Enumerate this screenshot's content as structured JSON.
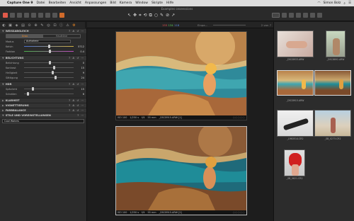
{
  "menubar": {
    "app_name": "Capture One 9",
    "menus": [
      "Datei",
      "Bearbeiten",
      "Ansicht",
      "Anpassungen",
      "Bild",
      "Kamera",
      "Window",
      "Skripte",
      "Hilfe"
    ],
    "user": "Simon Bolz"
  },
  "toolbar": {
    "document_name": "Examples ceseessions"
  },
  "tool_tabs": [
    "◐",
    "▣",
    "◈",
    "▤",
    "⊙",
    "⊕",
    "✎",
    "◎",
    "⊡",
    "ⓘ",
    "⚠",
    "⚙"
  ],
  "left_panel": {
    "white_balance": {
      "title": "WEISSABGLEICH",
      "tabs": [
        "Grau",
        "Hauttöne"
      ],
      "mode_label": "Modus",
      "mode_value": "Aufnahme",
      "kelvin_label": "Kelvin",
      "kelvin_value": "5712",
      "tint_label": "Farbton",
      "tint_value": "0.4"
    },
    "exposure": {
      "title": "BELICHTUNG",
      "rows": [
        {
          "label": "Belichtung",
          "value": "0",
          "pos": 0.5
        },
        {
          "label": "Kontrast",
          "value": "15",
          "pos": 0.58
        },
        {
          "label": "Helligkeit",
          "value": "9",
          "pos": 0.55
        },
        {
          "label": "Sättigung",
          "value": "24",
          "pos": 0.62
        }
      ]
    },
    "hdr": {
      "title": "HDR",
      "rows": [
        {
          "label": "Spitzlicht",
          "value": "15",
          "pos": 0.15
        },
        {
          "label": "Schatten",
          "value": "6",
          "pos": 0.06
        }
      ]
    },
    "collapsed_sections": [
      "KLARHEIT",
      "VIGNETTIERUNG",
      "FARBBALANCE",
      "STILE UND VOREINSTELLUNGEN"
    ],
    "style_value": "Cool Waters"
  },
  "viewer": {
    "rgb": {
      "r": "155",
      "g": "134",
      "b": "118"
    },
    "zoom_text": "Einpa...",
    "count": "2 von 7",
    "photos": [
      {
        "iso": "ISO 100",
        "shutter": "1/250 s",
        "aperture": "f/4",
        "focal": "55 mm",
        "file": "_DSC8915.ARW [1]"
      },
      {
        "iso": "ISO 100",
        "shutter": "1/250 s",
        "aperture": "f/4",
        "focal": "55 mm",
        "file": "_DSC8915.ARW [2]"
      }
    ]
  },
  "browser": {
    "thumbs": [
      {
        "caption": "_DSC8933.ARW"
      },
      {
        "caption": "_DSC8892.ARW"
      },
      {
        "caption": "_DSC8915.ARW"
      },
      {
        "caption": ""
      },
      {
        "caption": "_L9K0514.CR2"
      },
      {
        "caption": "_SB_0273.CR2"
      },
      {
        "caption": "_SB_0621.CR2"
      }
    ]
  },
  "colors": {
    "accent": "#f08a24",
    "panel": "#2b2b2b",
    "viewer_bg": "#1d1d1d"
  }
}
